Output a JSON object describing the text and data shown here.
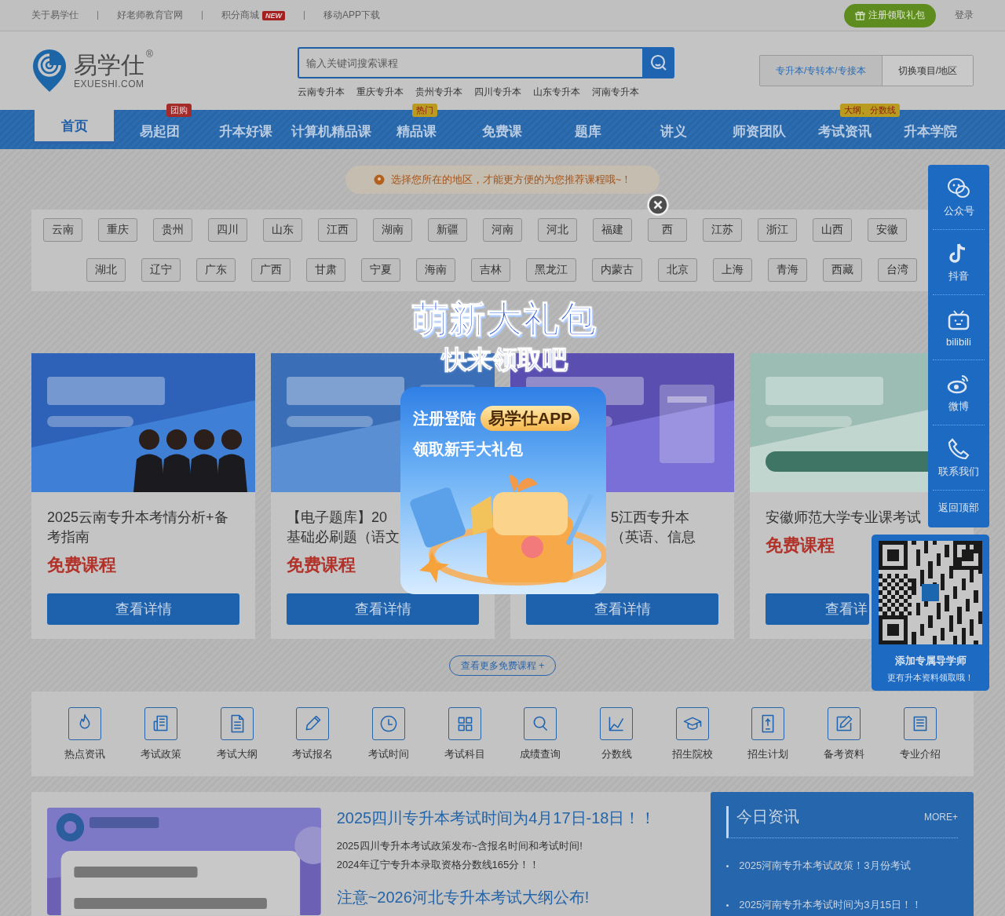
{
  "top_bar": {
    "links": [
      {
        "label": "关于易学仕"
      },
      {
        "label": "好老师教育官网"
      },
      {
        "label": "积分商城",
        "badge": "NEW"
      },
      {
        "label": "移动APP下载"
      }
    ],
    "register_button": "注册领取礼包",
    "login": "登录"
  },
  "header": {
    "logo": {
      "name": "易学仕",
      "mark": "®",
      "sub": "EXUESHI.COM"
    },
    "search": {
      "placeholder": "输入关键词搜索课程"
    },
    "hot_links": [
      "云南专升本",
      "重庆专升本",
      "贵州专升本",
      "四川专升本",
      "山东专升本",
      "河南专升本"
    ],
    "switcher": {
      "current": "专升本/专转本/专接本",
      "action": "切换项目/地区"
    }
  },
  "nav": [
    {
      "label": "首页",
      "selected": true
    },
    {
      "label": "易起团",
      "selected": false,
      "badge": {
        "text": "团购",
        "kind": "red"
      }
    },
    {
      "label": "升本好课",
      "selected": false
    },
    {
      "label": "计算机精品课",
      "selected": false
    },
    {
      "label": "精品课",
      "selected": false,
      "badge": {
        "text": "热门",
        "kind": "yellow"
      }
    },
    {
      "label": "免费课",
      "selected": false
    },
    {
      "label": "题库",
      "selected": false
    },
    {
      "label": "讲义",
      "selected": false
    },
    {
      "label": "师资团队",
      "selected": false
    },
    {
      "label": "考试资讯",
      "selected": false,
      "badge": {
        "text": "大纲、分数线",
        "kind": "yellow"
      }
    },
    {
      "label": "升本学院",
      "selected": false
    }
  ],
  "notice": "选择您所在的地区，才能更方便的为您推荐课程哦~！",
  "regions": [
    [
      "云南",
      "重庆",
      "贵州",
      "四川",
      "山东",
      "江西",
      "湖南",
      "新疆",
      "河南",
      "河北",
      "福建",
      "西",
      "江苏",
      "浙江",
      "山西",
      "安徽"
    ],
    [
      "湖北",
      "辽宁",
      "广东",
      "广西",
      "甘肃",
      "宁夏",
      "海南",
      "吉林",
      "黑龙江",
      "内蒙古",
      "北京",
      "上海",
      "青海",
      "西藏",
      "台湾"
    ]
  ],
  "courses": [
    {
      "title_lines": [
        "2025云南专升本考情分析+备",
        "考指南"
      ],
      "price": "免费课程",
      "button": "查看详情"
    },
    {
      "title_lines": [
        "【电子题库】20",
        "基础必刷题（语文"
      ],
      "price": "免费课程",
      "button": "查看详情"
    },
    {
      "title_lines": [
        "5江西专升本",
        "（英语、信息"
      ],
      "button": "查看详情"
    },
    {
      "title_lines": [
        "安徽师范大学专业课考试"
      ],
      "price": "免费课程",
      "button": "查看详"
    }
  ],
  "more_courses": "查看更多免费课程 +",
  "categories": [
    "热点资讯",
    "考试政策",
    "考试大纲",
    "考试报名",
    "考试时间",
    "考试科目",
    "成绩查询",
    "分数线",
    "招生院校",
    "招生计划",
    "备考资料",
    "专业介绍"
  ],
  "news": {
    "headlines": [
      {
        "title": "2025四川专升本考试时间为4月17日-18日！！",
        "items": [
          "2025四川专升本考试政策发布~含报名时间和考试时间!",
          "2024年辽宁专升本录取资格分数线165分！！"
        ]
      },
      {
        "title": "注意~2026河北专升本考试大纲公布!"
      }
    ],
    "today": {
      "title": "今日资讯",
      "more": "MORE+",
      "items": [
        "2025河南专升本考试政策！3月份考试",
        "2025河南专升本考试时间为3月15日！！"
      ]
    }
  },
  "sidebar": [
    "公众号",
    "抖音",
    "bilibili",
    "微博",
    "联系我们",
    "返回顶部"
  ],
  "qr_panel": {
    "title": "添加专属导学师",
    "subtitle": "更有升本资料领取哦！"
  },
  "popup": {
    "title": "萌新大礼包",
    "subtitle": "快来领取吧",
    "line1": "注册登陆",
    "app": "易学仕APP",
    "line2": "领取新手大礼包"
  }
}
